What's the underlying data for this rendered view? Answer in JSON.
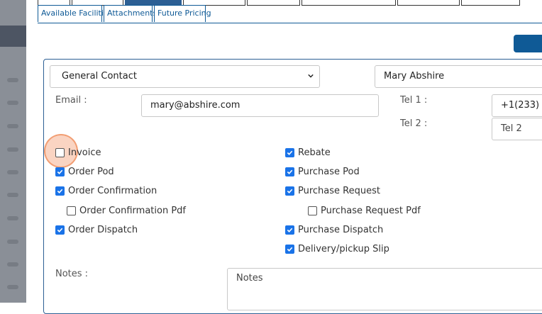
{
  "subtabs": [
    {
      "label": "Available Facilities"
    },
    {
      "label": "Attachments"
    },
    {
      "label": "Future Pricing"
    }
  ],
  "contact": {
    "type_select": {
      "value": "General Contact"
    },
    "name": {
      "value": "Mary Abshire"
    },
    "email": {
      "label": "Email :",
      "value": "mary@abshire.com"
    },
    "tel1": {
      "label": "Tel 1 :",
      "value": "+1(233)"
    },
    "tel2": {
      "label": "Tel 2 :",
      "placeholder": "Tel 2"
    }
  },
  "checkboxes_left": [
    {
      "label": "Invoice",
      "checked": false
    },
    {
      "label": "Order Pod",
      "checked": true
    },
    {
      "label": "Order Confirmation",
      "checked": true
    },
    {
      "label": "Order Confirmation Pdf",
      "checked": false
    },
    {
      "label": "Order Dispatch",
      "checked": true
    }
  ],
  "checkboxes_right": [
    {
      "label": "Rebate",
      "checked": true
    },
    {
      "label": "Purchase Pod",
      "checked": true
    },
    {
      "label": "Purchase Request",
      "checked": true
    },
    {
      "label": "Purchase Request Pdf",
      "checked": false
    },
    {
      "label": "Purchase Dispatch",
      "checked": true
    },
    {
      "label": "Delivery/pickup Slip",
      "checked": true
    }
  ],
  "notes": {
    "label": "Notes :",
    "placeholder": "Notes"
  },
  "colors": {
    "accent": "#0f5a96",
    "checkbox": "#1a73e8"
  }
}
